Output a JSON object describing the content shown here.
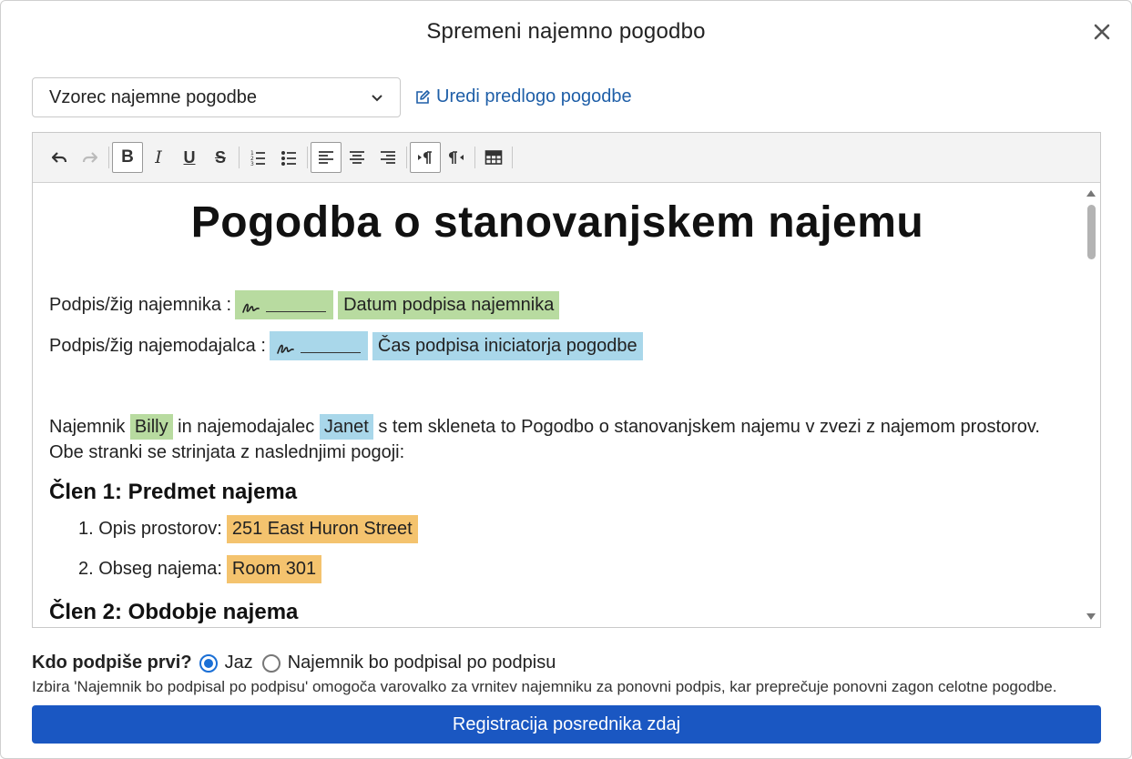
{
  "dialog": {
    "title": "Spremeni najemno pogodbo"
  },
  "template_select": {
    "value": "Vzorec najemne pogodbe"
  },
  "edit_template": {
    "label": "Uredi predlogo pogodbe"
  },
  "toolbar": {
    "buttons": [
      "undo",
      "redo",
      "bold",
      "italic",
      "underline",
      "strikethrough",
      "ordered-list",
      "bullet-list",
      "align-left",
      "align-center",
      "align-right",
      "ltr",
      "rtl",
      "table"
    ],
    "active": [
      "bold",
      "align-left",
      "ltr"
    ]
  },
  "document": {
    "title": "Pogodba o stanovanjskem najemu",
    "tenant_signature_label": "Podpis/žig najemnika :",
    "tenant_date_field": "Datum podpisa najemnika",
    "landlord_signature_label": "Podpis/žig najemodajalca :",
    "landlord_time_field": "Čas podpisa iniciatorja pogodbe",
    "intro_1": "Najemnik",
    "tenant_name": "Billy",
    "intro_2": "in najemodajalec",
    "landlord_name": "Janet",
    "intro_3": "s tem skleneta to Pogodbo o stanovanjskem najemu v zvezi z najemom prostorov. Obe stranki se strinjata z naslednjimi pogoji:",
    "article_1_title": "Člen 1: Predmet najema",
    "item_1_label": "1. Opis prostorov:",
    "item_1_value": "251 East Huron Street",
    "item_2_label": "2. Obseg najema:",
    "item_2_value": "Room 301",
    "article_2_title": "Člen 2: Obdobje najema"
  },
  "signing": {
    "question": "Kdo podpiše prvi?",
    "option_me": "Jaz",
    "option_tenant": "Najemnik bo podpisal po podpisu",
    "selected": "Jaz",
    "note": "Izbira 'Najemnik bo podpisal po podpisu' omogoča varovalko za vrnitev najemniku za ponovni podpis, kar preprečuje ponovni zagon celotne pogodbe."
  },
  "primary_button": {
    "label": "Registracija posrednika zdaj"
  },
  "colors": {
    "primary": "#1a57c2",
    "link": "#1f5fa8",
    "tenant_highlight": "#b8dba0",
    "landlord_highlight": "#a9d7ea",
    "property_highlight": "#f4c36e"
  }
}
